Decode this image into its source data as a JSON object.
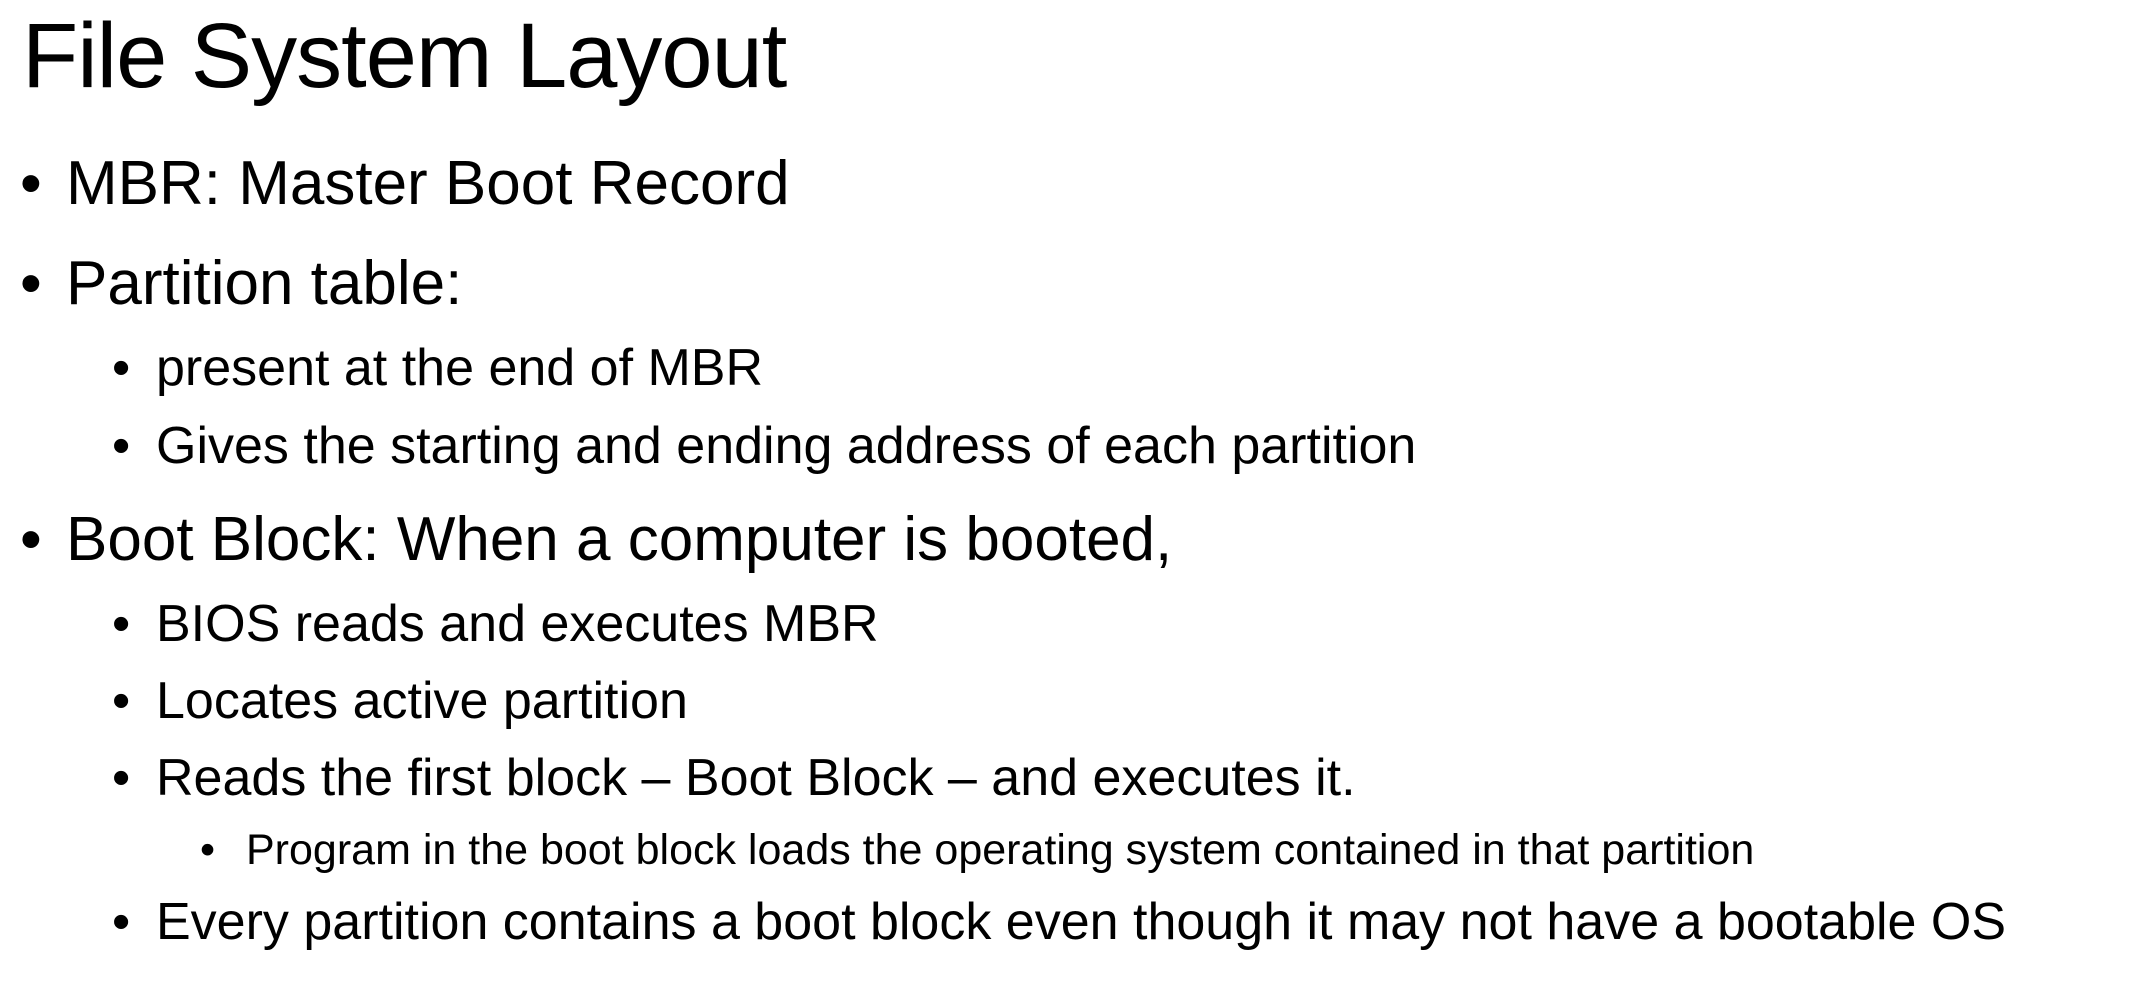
{
  "slide": {
    "title": "File System Layout",
    "bullet_glyph": "•",
    "items": [
      {
        "level": 1,
        "text": "MBR: Master Boot Record"
      },
      {
        "level": 1,
        "text": "Partition table:"
      },
      {
        "level": 2,
        "text": "present at the end of MBR"
      },
      {
        "level": 2,
        "text": "Gives the starting and ending address of each partition"
      },
      {
        "level": 1,
        "text": "Boot Block: When a computer is booted,"
      },
      {
        "level": 2,
        "text": "BIOS reads and executes MBR"
      },
      {
        "level": 2,
        "text": "Locates active partition"
      },
      {
        "level": 2,
        "text": "Reads the first block – Boot Block – and executes it."
      },
      {
        "level": 3,
        "text": "Program in the boot block loads the operating system contained in that partition"
      },
      {
        "level": 2,
        "text": "Every partition contains a boot block even though it may not have a bootable OS"
      }
    ]
  }
}
